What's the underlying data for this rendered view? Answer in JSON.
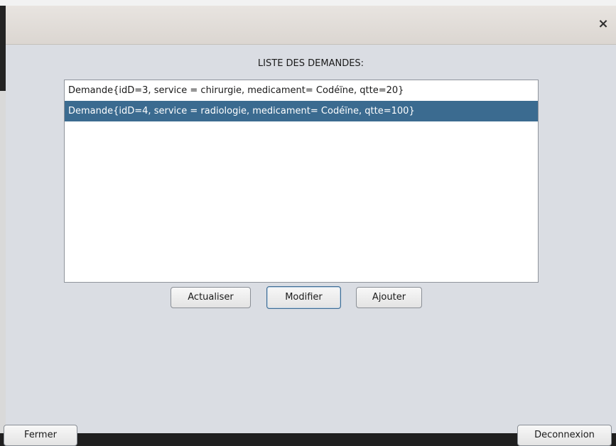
{
  "dialog": {
    "close_glyph": "×",
    "heading": "LISTE DES DEMANDES:"
  },
  "demandes": [
    {
      "text": "Demande{idD=3, service = chirurgie, medicament= Codéïne, qtte=20}",
      "selected": false
    },
    {
      "text": "Demande{idD=4, service = radiologie, medicament= Codéïne, qtte=100}",
      "selected": true
    }
  ],
  "buttons": {
    "actualiser": "Actualiser",
    "modifier": "Modifier",
    "ajouter": "Ajouter",
    "fermer": "Fermer",
    "deconnexion": "Deconnexion"
  },
  "colors": {
    "selection": "#3b6b90",
    "dialog_bg": "#dadde3"
  }
}
